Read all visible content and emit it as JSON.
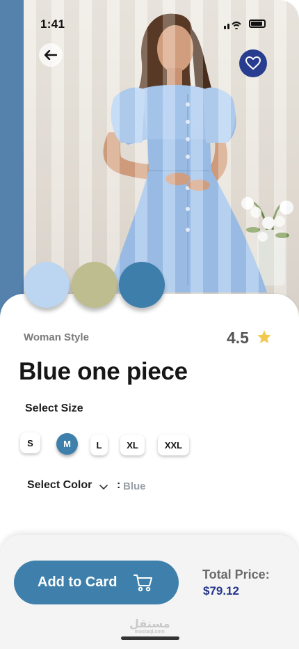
{
  "status_bar": {
    "time": "1:41"
  },
  "product": {
    "category": "Woman Style",
    "rating": "4.5",
    "name": "Blue one piece"
  },
  "swatches": [
    {
      "name": "light-blue",
      "color": "#bcd5f0"
    },
    {
      "name": "sage",
      "color": "#bdbd8f"
    },
    {
      "name": "steel-blue",
      "color": "#3d7eaa"
    }
  ],
  "size_section": {
    "label": "Select Size",
    "sizes": [
      "S",
      "M",
      "L",
      "XL",
      "XXL"
    ],
    "selected": "M"
  },
  "color_section": {
    "label": "Select Color",
    "separator": ":",
    "value": "Blue"
  },
  "cart": {
    "button_label": "Add to Card",
    "total_label": "Total Price:",
    "total_value": "$79.12"
  },
  "watermark": {
    "text": "مستقل",
    "sub": "mostaql.com"
  },
  "colors": {
    "accent": "#3e80ab",
    "favorite_bg": "#283d8f",
    "price": "#24348a",
    "star": "#f2c94c"
  },
  "icons": {
    "back": "arrow-left-icon",
    "favorite": "heart-icon",
    "rating": "star-icon",
    "dropdown": "chevron-down-icon",
    "cart": "shopping-cart-icon"
  }
}
